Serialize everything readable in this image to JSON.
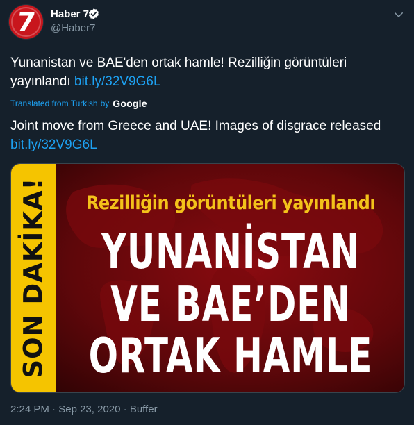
{
  "author": {
    "name": "Haber 7",
    "handle": "@Haber7",
    "avatar_text": "7",
    "verified": true
  },
  "tweet": {
    "text": "Yunanistan ve BAE'den ortak hamle! Rezilliğin görüntüleri yayınlandı",
    "link": "bit.ly/32V9G6L"
  },
  "translation": {
    "label": "Translated from Turkish",
    "by": "by",
    "provider": "Google",
    "text": "Joint move from Greece and UAE! Images of disgrace released",
    "link": "bit.ly/32V9G6L"
  },
  "media": {
    "ribbon": "SON DAKİKA!",
    "subhead": "Rezilliğin görüntüleri yayınlandı",
    "headline_lines": [
      "YUNANİSTAN",
      "VE BAE’DEN",
      "ORTAK HAMLE"
    ]
  },
  "meta": {
    "time": "2:24 PM",
    "separator": " · ",
    "date": "Sep 23, 2020",
    "source": "Buffer"
  },
  "colors": {
    "background": "#15202b",
    "accent": "#1da1f2",
    "muted": "#8899a6",
    "media_red": "#5a0608",
    "ribbon_yellow": "#f5c400"
  },
  "icons": {
    "verified": "verified-badge-icon",
    "menu": "chevron-down-icon"
  }
}
